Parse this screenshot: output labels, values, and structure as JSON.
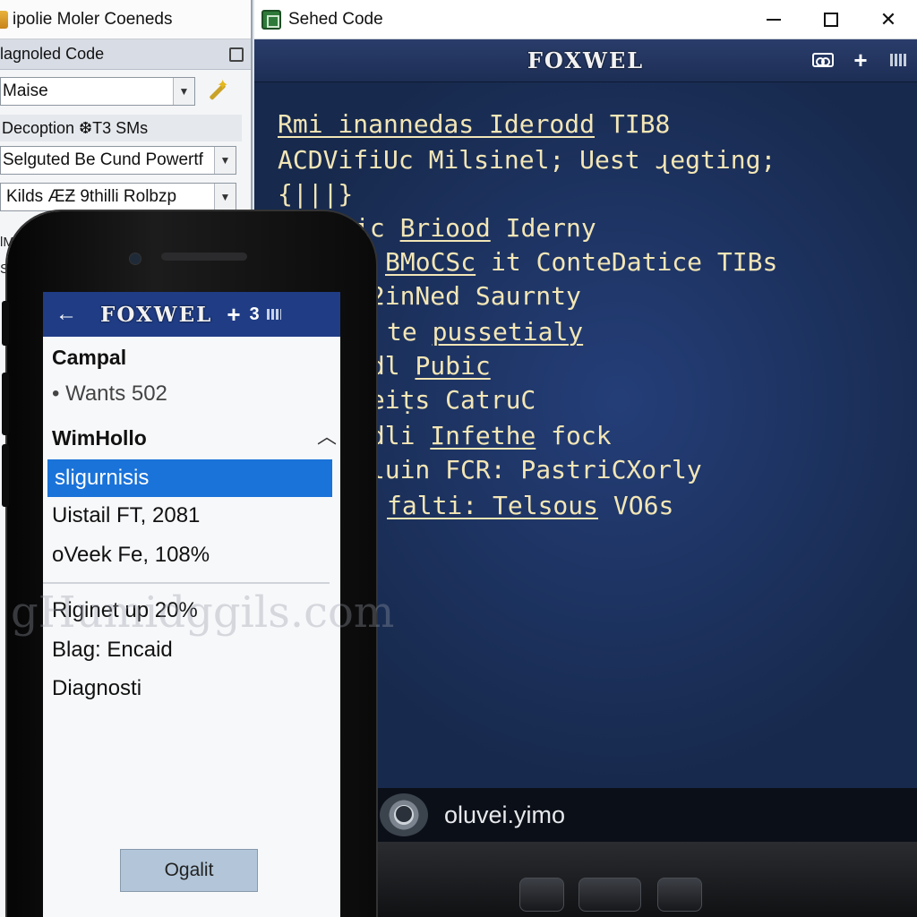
{
  "left_window": {
    "title": "ipolie Moler Coeneds",
    "header": "lagnoled Code",
    "combo1_value": "Maise",
    "label_strip": "Decoption ❆T3 SMs",
    "combo2_value": "Selguted Be Cund Powertf",
    "combo3_value": "Kilds ÆƵ 9thilli Rolbzp",
    "stub1": "lMs",
    "stub2": "S"
  },
  "right_window": {
    "title": "Sehed Code",
    "brand": "FOXWEL",
    "code_lines": [
      {
        "pre": "",
        "u": "Rmi inannedas Iderodd",
        "post": " TIB8"
      },
      {
        "pre": "ACDVifiUc Milsinel; Uest ɻegting;",
        "u": "",
        "post": ""
      },
      {
        "pre": "{|||}",
        "u": "",
        "post": ""
      },
      {
        "pre": "ic ",
        "u": "Briood",
        "post": " Iderny"
      },
      {
        "pre": "",
        "u": "BMoCSc",
        "post": " it ConteDatice TIBs"
      },
      {
        "pre": "d2inNed Saurnty",
        "u": "",
        "post": ""
      },
      {
        "pre": "te ",
        "u": "pussetialy",
        "post": ""
      },
      {
        "pre": "idl ",
        "u": "Pubic",
        "post": ""
      },
      {
        "pre": "meiṭs CatruC",
        "u": "",
        "post": ""
      },
      {
        "pre": "udli ",
        "u": "Infethe",
        "post": " fock"
      },
      {
        "pre": "hluin FCR: PastriCXorly",
        "u": "",
        "post": ""
      },
      {
        "pre": "",
        "u": "falti: Telsous",
        "post": " VO6s"
      }
    ],
    "footer_text": "oluvei.yimo"
  },
  "phone": {
    "brand": "FOXWEL",
    "back_icon": "arrow-left",
    "badge": "3",
    "item_campal": "Campal",
    "item_wants": "• Wants 502",
    "item_wimhollo": "WimHollo",
    "selected": "sligurnisis",
    "item_uistail": "Uistail FT, 2081",
    "item_oveek": "oVeek Fe, 108%",
    "item_riginet": "Riginet up 20%",
    "item_blag": "Blag: Encaid",
    "item_diag": "Diagnosti",
    "button": "Ogalit",
    "watermark": "gHumidggils.com"
  },
  "colors": {
    "accent_blue": "#1a73d9",
    "header_blue": "#1f3c85",
    "code_bg": "#17294c",
    "code_text": "#f3e6b6"
  }
}
